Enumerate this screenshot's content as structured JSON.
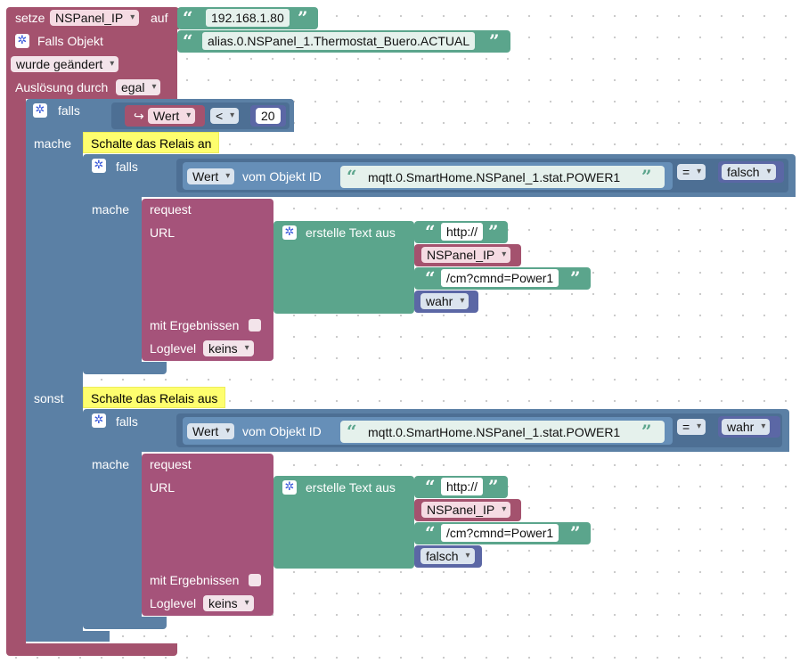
{
  "set_block": {
    "label": "setze",
    "variable": "NSPanel_IP",
    "label2": "auf",
    "value": "192.168.1.80"
  },
  "trigger": {
    "title": "Falls Objekt",
    "object_id": "alias.0.NSPanel_1.Thermostat_Buero.ACTUAL",
    "changed": "wurde geändert",
    "trigger_label": "Auslösung durch",
    "trigger_value": "egal"
  },
  "outer_if": {
    "falls": "falls",
    "var": "Wert",
    "op": "<",
    "number": "20",
    "mache": "mache",
    "sonst": "sonst"
  },
  "branch_on": {
    "comment": "Schalte das Relais an",
    "falls": "falls",
    "wert": "Wert",
    "from_object": "vom Objekt ID",
    "object_id": "mqtt.0.SmartHome.NSPanel_1.stat.POWER1",
    "op": "=",
    "compare": "falsch",
    "mache": "mache",
    "request": "request",
    "url": "URL",
    "create_text": "erstelle Text aus",
    "http": "http://",
    "var": "NSPanel_IP",
    "path": "/cm?cmnd=Power1",
    "bool": "wahr",
    "with_result": "mit Ergebnissen",
    "loglevel": "Loglevel",
    "loglevel_value": "keins"
  },
  "branch_off": {
    "comment": "Schalte das Relais aus",
    "falls": "falls",
    "wert": "Wert",
    "from_object": "vom Objekt ID",
    "object_id": "mqtt.0.SmartHome.NSPanel_1.stat.POWER1",
    "op": "=",
    "compare": "wahr",
    "mache": "mache",
    "request": "request",
    "url": "URL",
    "create_text": "erstelle Text aus",
    "http": "http://",
    "var": "NSPanel_IP",
    "path": "/cm?cmnd=Power1",
    "bool": "falsch",
    "with_result": "mit Ergebnissen",
    "loglevel": "Loglevel",
    "loglevel_value": "keins"
  },
  "icons": {
    "gear": "gear-icon",
    "quote_open": "quote-open-icon",
    "quote_close": "quote-close-icon",
    "return": "return-arrow-icon"
  },
  "colors": {
    "variables": "#a4526e",
    "text": "#5ba58c",
    "logic": "#5b80a5",
    "request": "#a5537a",
    "comment": "#fefe6e"
  }
}
